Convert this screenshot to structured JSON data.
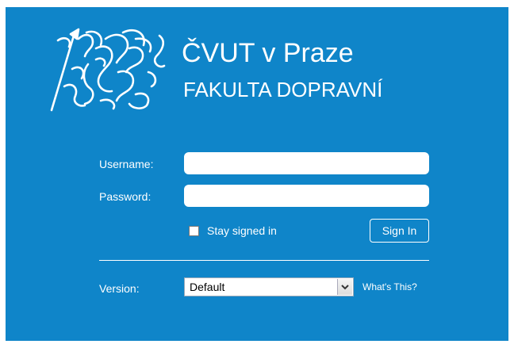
{
  "brand": {
    "title": "ČVUT v Praze",
    "subtitle": "FAKULTA DOPRAVNÍ",
    "logo_icon": "heraldic-lion-icon",
    "color": "#0f85c9"
  },
  "login": {
    "username_label": "Username:",
    "username_value": "",
    "password_label": "Password:",
    "password_value": "",
    "stay_signed_in_label": "Stay signed in",
    "stay_signed_in_checked": false,
    "sign_in_label": "Sign In"
  },
  "version": {
    "label": "Version:",
    "selected": "Default",
    "whats_this_label": "What's This?"
  }
}
